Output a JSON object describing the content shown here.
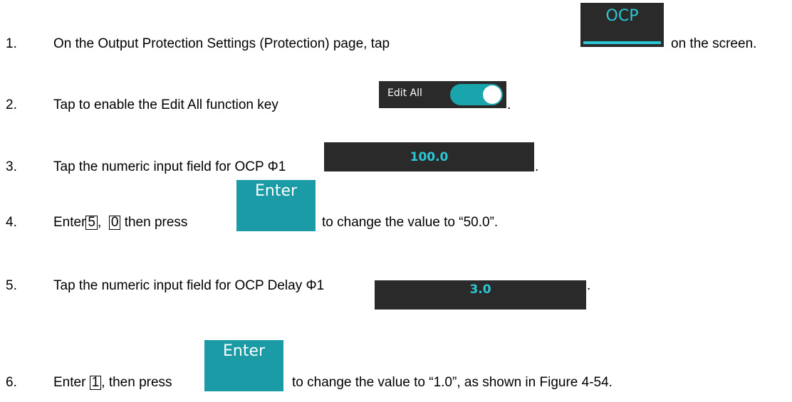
{
  "steps": [
    {
      "number": "1.",
      "before": "On the Output Protection Settings (Protection) page, tap",
      "after": "on the screen."
    },
    {
      "number": "2.",
      "before": "Tap to enable the Edit All function key",
      "after": "."
    },
    {
      "number": "3.",
      "before": "Tap the numeric input field for OCP Φ1",
      "after": "."
    },
    {
      "number": "4.",
      "before": "Enter",
      "key1": "5",
      "comma": ",",
      "key2": "0",
      "mid": "then press",
      "after": "to change the value to “50.0”."
    },
    {
      "number": "5.",
      "before": "Tap the numeric input field for OCP Delay Φ1",
      "after": "."
    },
    {
      "number": "6.",
      "before": "Enter",
      "key1": "1",
      "mid": ", then press",
      "after": "to change the value to “1.0”, as shown in Figure 4-54."
    }
  ],
  "images": {
    "ocp_tab_label": "OCP",
    "edit_all_label": "Edit All",
    "edit_all_on": true,
    "ocp_value": "100.0",
    "enter_label": "Enter",
    "ocp_delay_value": "3.0"
  },
  "colors": {
    "accent_cyan": "#2bc7d4",
    "enter_teal": "#1a9ba6",
    "toggle_teal": "#1aa5ac",
    "panel_dark": "#2a2a2a"
  }
}
